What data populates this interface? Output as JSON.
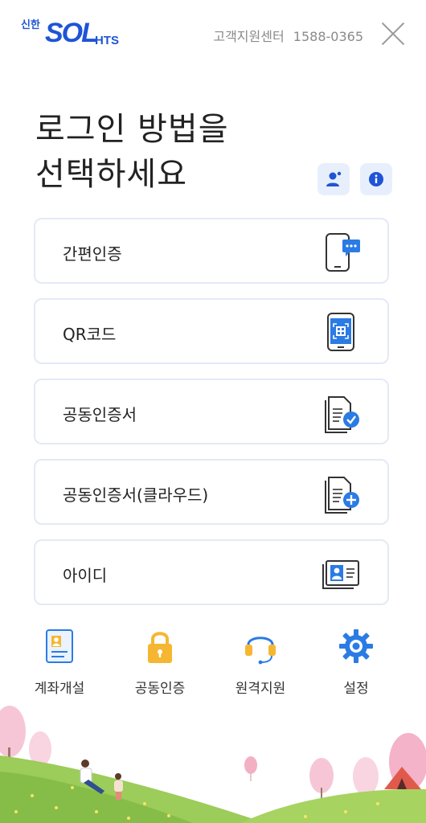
{
  "header": {
    "logo_small": "신한",
    "logo_main": "SOL",
    "logo_suffix": "HTS",
    "support_label": "고객지원센터",
    "support_phone": "1588-0365"
  },
  "title": {
    "line1": "로그인 방법을",
    "line2": "선택하세요"
  },
  "options": [
    {
      "label": "간편인증",
      "icon": "phone-chat-icon"
    },
    {
      "label": "QR코드",
      "icon": "qr-phone-icon"
    },
    {
      "label": "공동인증서",
      "icon": "certificate-check-icon"
    },
    {
      "label": "공동인증서(클라우드)",
      "icon": "certificate-add-icon"
    },
    {
      "label": "아이디",
      "icon": "id-card-icon"
    }
  ],
  "bottom_menu": [
    {
      "label": "계좌개설",
      "icon": "account-card-icon"
    },
    {
      "label": "공동인증",
      "icon": "lock-icon"
    },
    {
      "label": "원격지원",
      "icon": "headset-icon"
    },
    {
      "label": "설정",
      "icon": "gear-icon"
    }
  ],
  "colors": {
    "brand": "#1f54d6",
    "accent": "#2b7be4",
    "border": "#e4e9f5",
    "light_blue_bg": "#e8effc"
  }
}
